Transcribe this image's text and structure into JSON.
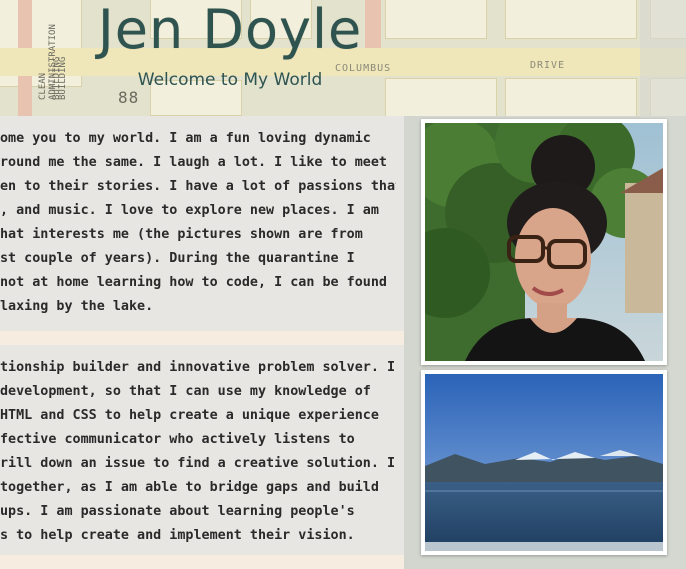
{
  "header": {
    "name": "Jen Doyle",
    "tagline": "Welcome to My World"
  },
  "map_labels": {
    "columbus": "COLUMBUS",
    "drive": "DRIVE",
    "left_vertical_1": "CLEAN ADMINISTRATION BUILDING",
    "left_vertical_2": "BUILDING",
    "left_number": "88"
  },
  "about": {
    "lines": [
      "ome you to my world. I am a fun loving dynamic",
      "round me the same. I laugh a lot. I like to meet",
      "en to their stories. I have a lot of passions that",
      ", and music. I love to explore new places. I am",
      "hat interests me (the pictures shown are from",
      "st couple of years). During the quarantine I",
      "not at home learning how to code, I can be found",
      "laxing by the lake."
    ]
  },
  "skills": {
    "lines": [
      "tionship builder and innovative problem solver. I",
      "development, so that I can use my knowledge of",
      "HTML and CSS to help create a unique experience",
      "fective communicator who actively listens to",
      "rill down an issue to find a creative solution. I am",
      "together, as I am able to bridge gaps and build",
      "ups. I am passionate about learning people's",
      "s to help create and implement their vision."
    ]
  },
  "photos": {
    "portrait": "portrait-photo",
    "lake": "lake-photo"
  },
  "colors": {
    "title": "#2f5450",
    "card_bg": "#e8e6e2",
    "divider": "#f6ecdf"
  }
}
